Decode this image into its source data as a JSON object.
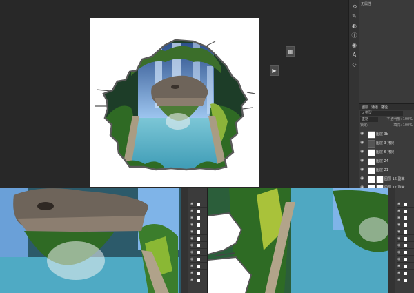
{
  "properties": {
    "title": "无属性"
  },
  "toolbar_icons": [
    "history-icon",
    "brush-preset-icon",
    "adjustments-icon",
    "info-icon",
    "color-icon",
    "character-icon",
    "3d-icon",
    "tools-icon"
  ],
  "float_buttons": {
    "one": "▦",
    "two": "▶"
  },
  "layers": {
    "tabs": [
      "图层",
      "通道",
      "路径"
    ],
    "filter": "p 类型",
    "blend_mode": "正常",
    "opacity": "不透明度: 100%",
    "lock": "锁定:",
    "fill": "填充: 100%",
    "rows": [
      {
        "name": "图层 3b",
        "thumb": "white",
        "mask": false
      },
      {
        "name": "图层 3 拷贝",
        "thumb": "dark",
        "mask": false
      },
      {
        "name": "图层 6 拷贝",
        "thumb": "white",
        "mask": false
      },
      {
        "name": "图层 24",
        "thumb": "white",
        "mask": false
      },
      {
        "name": "图层 21",
        "thumb": "white",
        "mask": false
      },
      {
        "name": "图层 16 副本",
        "thumb": "white",
        "mask": true
      },
      {
        "name": "图层 15 副本",
        "thumb": "white",
        "mask": true
      }
    ]
  },
  "colors": {
    "app_bg": "#282828",
    "panel": "#3b3b3b",
    "water": "#5fb3c6",
    "waterfall": "#7fb4e8",
    "foliage": "#3d7a2e",
    "rock": "#6e645a"
  }
}
